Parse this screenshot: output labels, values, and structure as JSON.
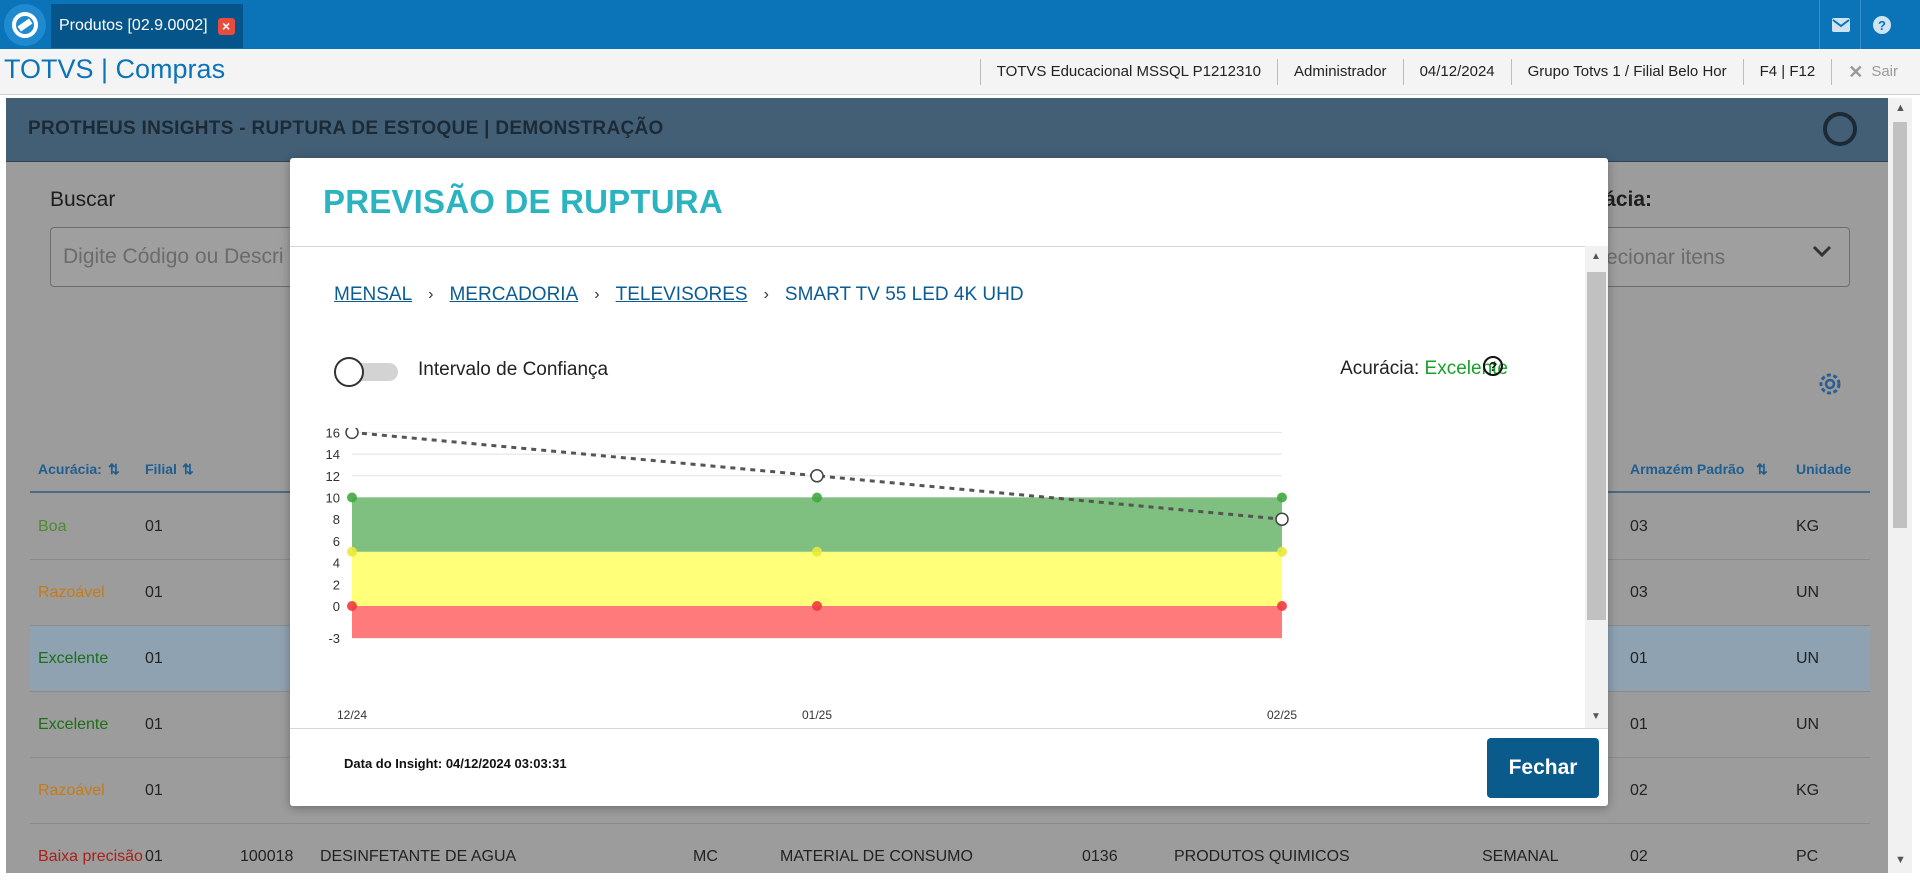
{
  "tab": {
    "label": "Produtos [02.9.0002]"
  },
  "app": {
    "title": "TOTVS | Compras",
    "environment": "TOTVS Educacional MSSQL P1212310",
    "user": "Administrador",
    "date": "04/12/2024",
    "branch": "Grupo Totvs 1 / Filial Belo Hor",
    "shortcuts": "F4 | F12",
    "exit_label": "Sair"
  },
  "page": {
    "title": "PROTHEUS INSIGHTS - RUPTURA DE ESTOQUE | DEMONSTRAÇÃO",
    "search_label": "Buscar",
    "search_placeholder": "Digite Código ou Descri",
    "accuracy_label": "rácia:",
    "accuracy_select_placeholder": "ecionar itens"
  },
  "table": {
    "headers": {
      "acuracia": "Acurácia:",
      "filial": "Filial",
      "armazem": "Armazém Padrão",
      "unidade": "Unidade"
    },
    "rows": [
      {
        "acuracia": "Boa",
        "color": "#4e8a30",
        "filial": "01",
        "armazem": "03",
        "unidade": "KG"
      },
      {
        "acuracia": "Razoável",
        "color": "#c77a14",
        "filial": "01",
        "armazem": "03",
        "unidade": "UN"
      },
      {
        "acuracia": "Excelente",
        "color": "#1e6e16",
        "filial": "01",
        "armazem": "01",
        "unidade": "UN"
      },
      {
        "acuracia": "Excelente",
        "color": "#1e6e16",
        "filial": "01",
        "armazem": "01",
        "unidade": "UN"
      },
      {
        "acuracia": "Razoável",
        "color": "#c77a14",
        "filial": "01",
        "armazem": "02",
        "unidade": "KG"
      },
      {
        "acuracia": "Baixa precisão",
        "color": "#a8221a",
        "filial": "01",
        "codigo": "100018",
        "descricao": "DESINFETANTE DE AGUA",
        "tipo": "MC",
        "tipo_desc": "MATERIAL DE CONSUMO",
        "grupo": "0136",
        "grupo_desc": "PRODUTOS QUIMICOS",
        "periodicidade": "SEMANAL",
        "armazem": "02",
        "unidade": "PC"
      }
    ]
  },
  "modal": {
    "title": "PREVISÃO DE RUPTURA",
    "breadcrumb": [
      "MENSAL",
      "MERCADORIA",
      "TELEVISORES",
      "SMART TV 55 LED 4K UHD"
    ],
    "toggle_label": "Intervalo de Confiança",
    "accuracy_label": "Acurácia:",
    "accuracy_value": "Excelente",
    "insight_date": "Data do Insight: 04/12/2024 03:03:31",
    "close_label": "Fechar"
  },
  "chart_data": {
    "type": "area",
    "categories": [
      "12/24",
      "01/25",
      "02/25"
    ],
    "y_ticks": [
      -3,
      0,
      2,
      4,
      6,
      8,
      10,
      12,
      14,
      16
    ],
    "ylim": [
      -3,
      16
    ],
    "bands": [
      {
        "color": "#ff7b7b",
        "from": -3,
        "to": 0
      },
      {
        "color": "#ffff7a",
        "from": 0,
        "to": 5
      },
      {
        "color": "#7fbf7f",
        "from": 5,
        "to": 10
      }
    ],
    "series": [
      {
        "values": [
          16,
          12,
          8
        ],
        "style": "dotted",
        "color": "#555555"
      }
    ],
    "band_markers": [
      {
        "color": "#3fa83f",
        "value": 10
      },
      {
        "color": "#e9e93a",
        "value": 5
      },
      {
        "color": "#ef3b3b",
        "value": 0
      }
    ],
    "grid": true
  }
}
